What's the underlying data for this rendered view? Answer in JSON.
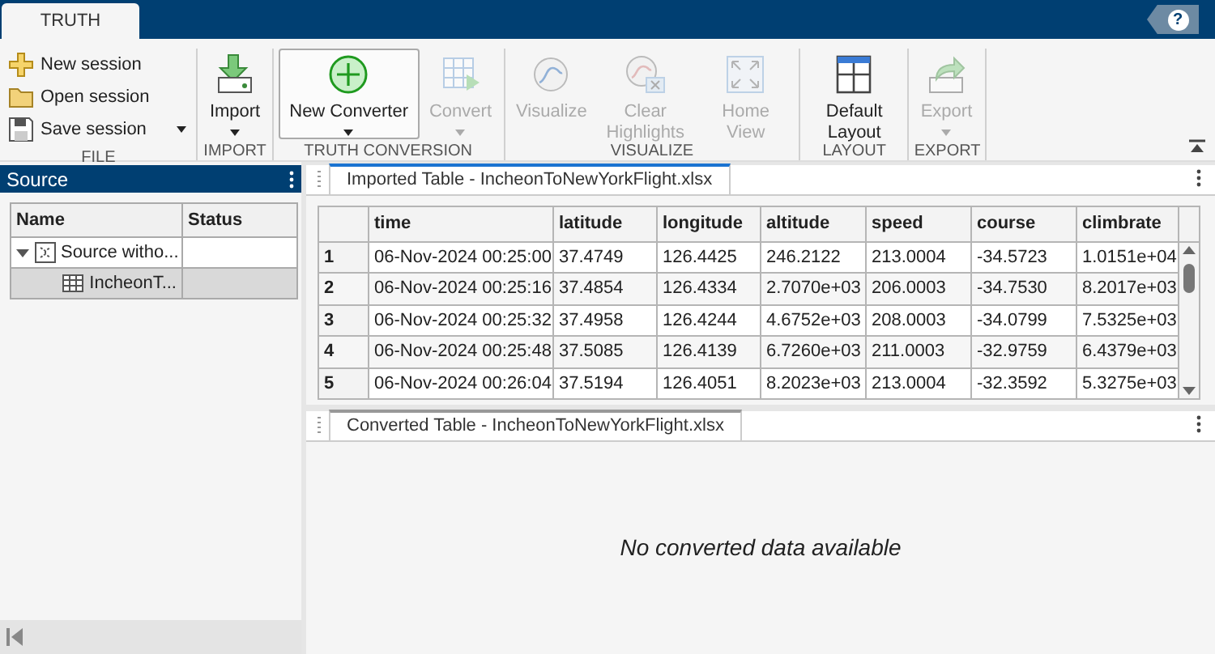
{
  "top_bar": {
    "tabs": [
      {
        "label": "TRUTH",
        "selected": true
      }
    ],
    "help": {
      "label": "?"
    }
  },
  "ribbon": {
    "sections": [
      {
        "title": "FILE",
        "items": [
          {
            "kind": "small",
            "label": "New session",
            "disabled": false,
            "dropdown": false,
            "highlighted": false
          },
          {
            "kind": "small",
            "label": "Open session",
            "disabled": false,
            "dropdown": false,
            "highlighted": false
          },
          {
            "kind": "small",
            "label": "Save session",
            "disabled": false,
            "dropdown": true,
            "highlighted": false
          }
        ]
      },
      {
        "title": "IMPORT",
        "items": [
          {
            "kind": "large",
            "label": "Import",
            "disabled": false,
            "dropdown": true,
            "highlighted": false
          }
        ]
      },
      {
        "title": "TRUTH CONVERSION",
        "items": [
          {
            "kind": "large",
            "label": "New Converter",
            "disabled": false,
            "dropdown": true,
            "highlighted": true
          },
          {
            "kind": "large",
            "label": "Convert",
            "disabled": true,
            "dropdown": true,
            "highlighted": false
          }
        ]
      },
      {
        "title": "VISUALIZE",
        "items": [
          {
            "kind": "large",
            "label": "Visualize",
            "disabled": true,
            "dropdown": false,
            "highlighted": false
          },
          {
            "kind": "large",
            "label": "Clear Highlights",
            "disabled": true,
            "dropdown": false,
            "highlighted": false
          },
          {
            "kind": "large",
            "label": "Home View",
            "disabled": true,
            "dropdown": false,
            "highlighted": false
          }
        ]
      },
      {
        "title": "LAYOUT",
        "items": [
          {
            "kind": "large",
            "label": "Default Layout",
            "disabled": false,
            "dropdown": false,
            "highlighted": false
          }
        ]
      },
      {
        "title": "EXPORT",
        "items": [
          {
            "kind": "large",
            "label": "Export",
            "disabled": true,
            "dropdown": true,
            "highlighted": false
          }
        ]
      }
    ]
  },
  "source_panel": {
    "title": "Source",
    "columns": [
      "Name",
      "Status"
    ],
    "tree": [
      {
        "kind": "source",
        "name": "Source witho...",
        "expanded": true,
        "selected": false,
        "children": [
          {
            "kind": "table",
            "name": "IncheonT...",
            "selected": true
          }
        ]
      }
    ]
  },
  "imported_panel": {
    "tab": {
      "label": "Imported Table - IncheonToNewYorkFlight.xlsx",
      "active": true
    },
    "table": {
      "columns": [
        "time",
        "latitude",
        "longitude",
        "altitude",
        "speed",
        "course",
        "climbrate"
      ],
      "rows": [
        {
          "index": "1",
          "cells": [
            "06-Nov-2024 00:25:00",
            "37.4749",
            "126.4425",
            "246.2122",
            "213.0004",
            "-34.5723",
            "1.0151e+04"
          ]
        },
        {
          "index": "2",
          "cells": [
            "06-Nov-2024 00:25:16",
            "37.4854",
            "126.4334",
            "2.7070e+03",
            "206.0003",
            "-34.7530",
            "8.2017e+03"
          ]
        },
        {
          "index": "3",
          "cells": [
            "06-Nov-2024 00:25:32",
            "37.4958",
            "126.4244",
            "4.6752e+03",
            "208.0003",
            "-34.0799",
            "7.5325e+03"
          ]
        },
        {
          "index": "4",
          "cells": [
            "06-Nov-2024 00:25:48",
            "37.5085",
            "126.4139",
            "6.7260e+03",
            "211.0003",
            "-32.9759",
            "6.4379e+03"
          ]
        },
        {
          "index": "5",
          "cells": [
            "06-Nov-2024 00:26:04",
            "37.5194",
            "126.4051",
            "8.2023e+03",
            "213.0004",
            "-32.3592",
            "5.3275e+03"
          ]
        }
      ]
    }
  },
  "converted_panel": {
    "tab": {
      "label": "Converted Table - IncheonToNewYorkFlight.xlsx",
      "active": false
    },
    "message": "No converted data available"
  }
}
